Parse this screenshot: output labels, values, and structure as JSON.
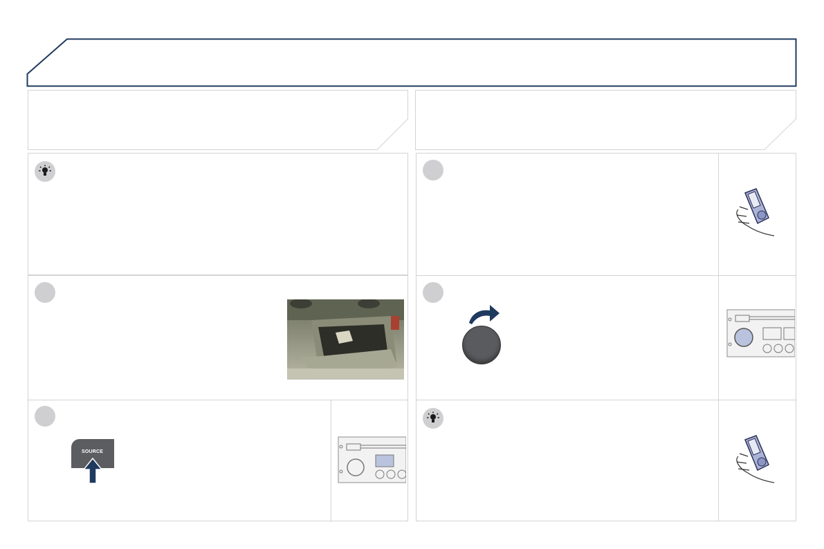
{
  "header": {
    "title": ""
  },
  "left": {
    "heading": "",
    "tip_text": "",
    "step1_text": "",
    "step2_text": "",
    "source_button_label": "SOURCE"
  },
  "right": {
    "heading": "",
    "step1_text": "",
    "step2_text": "",
    "tip_text": ""
  },
  "colors": {
    "header_border": "#1f3a5f",
    "panel_border": "#d3d3d3",
    "bullet": "#cfcfd1",
    "arrow": "#1f3a5f",
    "knob": "#5a5b5e",
    "source_button": "#5b5d60"
  },
  "icons": [
    "lightbulb-icon",
    "rotate-arrow-icon",
    "up-arrow-icon",
    "portable-player-illustration",
    "radio-faceplate-illustration"
  ]
}
